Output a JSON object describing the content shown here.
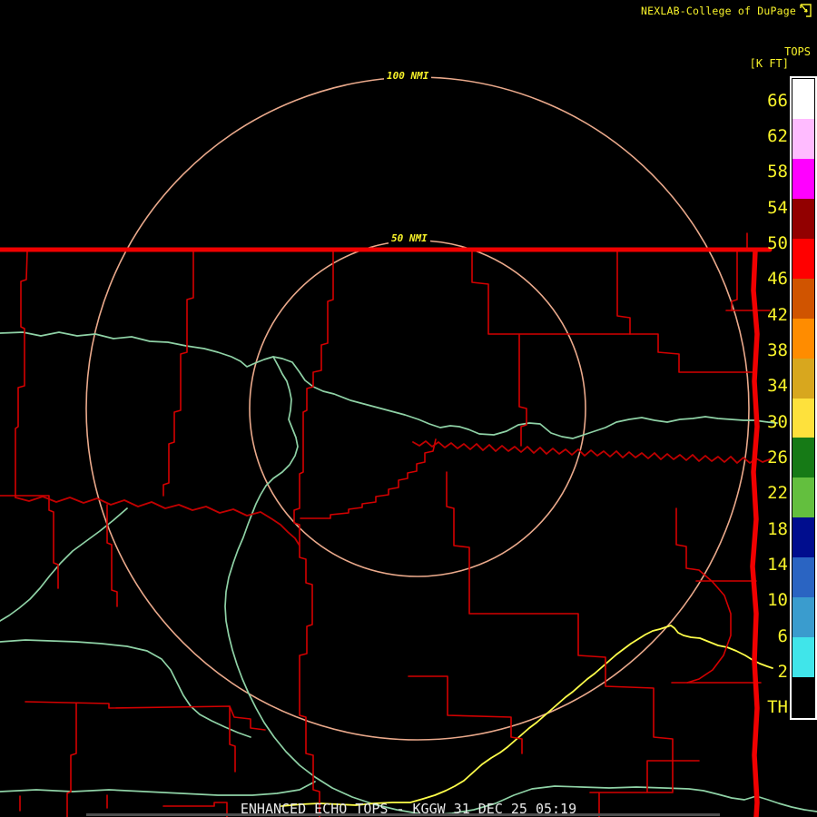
{
  "header": {
    "brand": "NEXLAB-College of DuPage",
    "logo_icon": "box-arrow-icon"
  },
  "legend": {
    "title_line1": "TOPS",
    "title_line2": "[K FT]",
    "unit": "K FT",
    "labels": [
      "66",
      "62",
      "58",
      "54",
      "50",
      "46",
      "42",
      "38",
      "34",
      "30",
      "26",
      "22",
      "18",
      "14",
      "10",
      "6",
      "2",
      "TH"
    ],
    "segment_colors": [
      "#ffffff",
      "#ffbbff",
      "#ff00ff",
      "#920000",
      "#ff0000",
      "#d05400",
      "#ff8c00",
      "#d8a71e",
      "#fee13c",
      "#167a16",
      "#63bf3e",
      "#000d8e",
      "#2a64c2",
      "#3a9cce",
      "#40e5ea",
      "#000000"
    ]
  },
  "range_rings": {
    "outer_label": "100 NMI",
    "inner_label": "50 NMI"
  },
  "caption": "ENHANCED ECHO TOPS - KGGW 31 DEC 25 05:19",
  "colors": {
    "background": "#000000",
    "yellow": "#f8f32a",
    "county": "#d40000",
    "border": "#f00000",
    "wavy": "#c20000",
    "river": "#8fd2a6",
    "road": "#ffff4a",
    "ring": "#eaa98b",
    "bar": "#4d4d4d"
  }
}
